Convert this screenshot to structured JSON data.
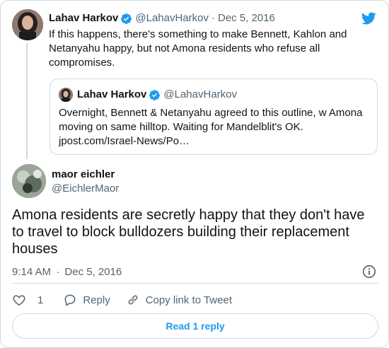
{
  "parent_tweet": {
    "author_name": "Lahav Harkov",
    "author_handle": "@LahavHarkov",
    "separator": "·",
    "date": "Dec 5, 2016",
    "text": "If this happens, there's something to make Bennett, Kahlon and Netanyahu happy, but not Amona residents who refuse all compromises."
  },
  "quoted_tweet": {
    "author_name": "Lahav Harkov",
    "author_handle": "@LahavHarkov",
    "text": "Overnight, Bennett & Netanyahu agreed to this outline, w Amona moving on same hilltop. Waiting for Mandelblit's OK.",
    "link": "jpost.com/Israel-News/Po…"
  },
  "main_tweet": {
    "author_name": "maor eichler",
    "author_handle": "@EichlerMaor",
    "text": "Amona residents are secretly happy that they don't have to travel to block bulldozers building their replacement houses",
    "time": "9:14 AM",
    "separator": "·",
    "date": "Dec 5, 2016"
  },
  "actions": {
    "like_count": "1",
    "reply_label": "Reply",
    "copy_label": "Copy link to Tweet"
  },
  "read_replies_label": "Read 1 reply",
  "icons": {
    "brand": "twitter-bird-icon",
    "verified": "verified-badge-icon",
    "info": "info-icon",
    "like": "heart-icon",
    "reply": "speech-bubble-icon",
    "copy": "link-icon"
  },
  "colors": {
    "accent": "#1d9bf0",
    "text": "#0f1419",
    "muted": "#536471",
    "border": "#cfd9de"
  }
}
